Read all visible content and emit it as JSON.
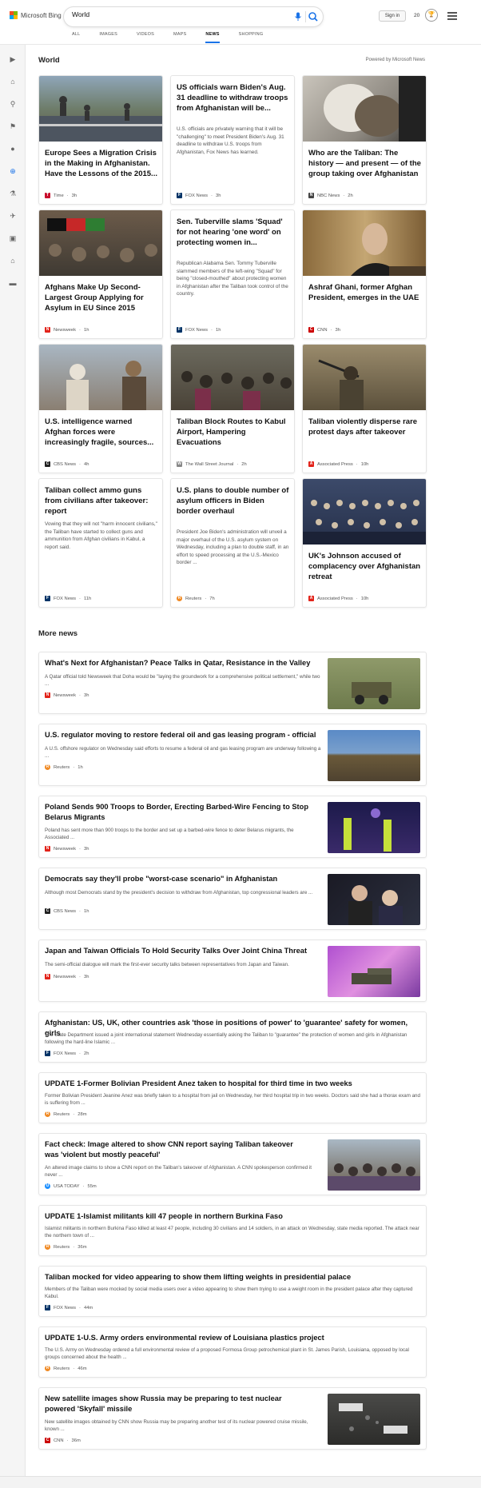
{
  "header": {
    "logo_text": "Microsoft Bing",
    "search_value": "World",
    "signin_label": "Sign in",
    "points": "20"
  },
  "tabs": [
    {
      "label": "ALL"
    },
    {
      "label": "IMAGES"
    },
    {
      "label": "VIDEOS"
    },
    {
      "label": "MAPS"
    },
    {
      "label": "NEWS",
      "active": true
    },
    {
      "label": "SHOPPING"
    }
  ],
  "rail_icons": [
    "chevron-right-icon",
    "home-icon",
    "sports-icon",
    "flag-icon",
    "location-icon",
    "globe-icon",
    "science-icon",
    "rocket-icon",
    "entertainment-icon",
    "politics-icon",
    "money-icon"
  ],
  "section": {
    "title": "World",
    "powered": "Powered by Microsoft News"
  },
  "cards": [
    {
      "title": "Europe Sees a Migration Crisis in the Making in Afghanistan. Have the Lessons of the 2015...",
      "snippet": "",
      "source": "Time",
      "time": "3h",
      "src_color": "#c8102e",
      "src_letter": "T",
      "img": true
    },
    {
      "title": "US officials warn Biden's Aug. 31 deadline to withdraw troops from Afghanistan will be...",
      "snippet": "U.S. officials are privately warning that it will be \"challenging\" to meet President Biden's Aug. 31 deadline to withdraw U.S. troops from Afghanistan, Fox News has learned.",
      "source": "FOX News",
      "time": "3h",
      "src_color": "#003366",
      "src_letter": "F",
      "img": false
    },
    {
      "title": "Who are the Taliban: The history — and present — of the group taking over Afghanistan",
      "snippet": "",
      "source": "NBC News",
      "time": "2h",
      "src_color": "#444",
      "src_letter": "N",
      "img": true
    },
    {
      "title": "Afghans Make Up Second-Largest Group Applying for Asylum in EU Since 2015",
      "snippet": "",
      "source": "Newsweek",
      "time": "1h",
      "src_color": "#e2231a",
      "src_letter": "N",
      "img": true
    },
    {
      "title": "Sen. Tuberville slams 'Squad' for not hearing 'one word' on protecting women in...",
      "snippet": "Republican Alabama Sen. Tommy Tuberville slammed members of the left-wing \"Squad\" for being \"closed-mouthed\" about protecting women in Afghanistan after the Taliban took control of the country.",
      "source": "FOX News",
      "time": "1h",
      "src_color": "#003366",
      "src_letter": "F",
      "img": false
    },
    {
      "title": "Ashraf Ghani, former Afghan President, emerges in the UAE",
      "snippet": "",
      "source": "CNN",
      "time": "3h",
      "src_color": "#cc0000",
      "src_letter": "C",
      "img": true
    },
    {
      "title": "U.S. intelligence warned Afghan forces were increasingly fragile, sources...",
      "snippet": "",
      "source": "CBS News",
      "time": "4h",
      "src_color": "#222",
      "src_letter": "C",
      "img": true
    },
    {
      "title": "Taliban Block Routes to Kabul Airport, Hampering Evacuations",
      "snippet": "",
      "source": "The Wall Street Journal",
      "time": "2h",
      "src_color": "#888",
      "src_letter": "W",
      "img": true
    },
    {
      "title": "Taliban violently disperse rare protest days after takeover",
      "snippet": "",
      "source": "Associated Press",
      "time": "10h",
      "src_color": "#e2231a",
      "src_letter": "A",
      "img": true
    },
    {
      "title": "Taliban collect ammo guns from civilians after takeover: report",
      "snippet": "Vowing that they will not \"harm innocent civilians,\" the Taliban have started to collect guns and ammunition from Afghan civilians in Kabul, a report said.",
      "source": "FOX News",
      "time": "11h",
      "src_color": "#003366",
      "src_letter": "F",
      "img": false
    },
    {
      "title": "U.S. plans to double number of asylum officers in Biden border overhaul",
      "snippet": "President Joe Biden's administration will unveil a major overhaul of the U.S. asylum system on Wednesday, including a plan to double staff, in an effort to speed processing at the U.S.-Mexico border ...",
      "source": "Reuters",
      "time": "7h",
      "src_color": "#f08a24",
      "src_letter": "R",
      "img": false
    },
    {
      "title": "UK's Johnson accused of complacency over Afghanistan retreat",
      "snippet": "",
      "source": "Associated Press",
      "time": "10h",
      "src_color": "#e2231a",
      "src_letter": "A",
      "img": true
    }
  ],
  "more": {
    "title": "More news"
  },
  "news": [
    {
      "title": "What's Next for Afghanistan? Peace Talks in Qatar, Resistance in the Valley",
      "snippet": "A Qatar official told Newsweek that Doha would be \"laying the groundwork for a comprehensive political settlement,\" while two ...",
      "source": "Newsweek",
      "time": "3h",
      "src_color": "#e2231a",
      "src_letter": "N",
      "img": true
    },
    {
      "title": "U.S. regulator moving to restore federal oil and gas leasing program - official",
      "snippet": "A U.S. offshore regulator on Wednesday said efforts to resume a federal oil and gas leasing program are underway following a ...",
      "source": "Reuters",
      "time": "1h",
      "src_color": "#f08a24",
      "src_letter": "R",
      "img": true
    },
    {
      "title": "Poland Sends 900 Troops to Border, Erecting Barbed-Wire Fencing to Stop Belarus Migrants",
      "snippet": "Poland has sent more than 900 troops to the border and set up a barbed-wire fence to deter Belarus migrants, the Associated ...",
      "source": "Newsweek",
      "time": "3h",
      "src_color": "#e2231a",
      "src_letter": "N",
      "img": true
    },
    {
      "title": "Democrats say they'll probe \"worst-case scenario\" in Afghanistan",
      "snippet": "Although most Democrats stand by the president's decision to withdraw from Afghanistan, top congressional leaders are ...",
      "source": "CBS News",
      "time": "1h",
      "src_color": "#222",
      "src_letter": "C",
      "img": true
    },
    {
      "title": "Japan and Taiwan Officials To Hold Security Talks Over Joint China Threat",
      "snippet": "The semi-official dialogue will mark the first-ever security talks between representatives from Japan and Taiwan.",
      "source": "Newsweek",
      "time": "3h",
      "src_color": "#e2231a",
      "src_letter": "N",
      "img": true
    },
    {
      "title": "Afghanistan: US, UK, other countries ask 'those in positions of power' to 'guarantee' safety for women, girls",
      "snippet": "The State Department issued a joint international statement Wednesday essentially asking the Taliban to \"guarantee\" the protection of women and girls in Afghanistan following the hard-line Islamic ...",
      "source": "FOX News",
      "time": "2h",
      "src_color": "#003366",
      "src_letter": "F",
      "img": false
    },
    {
      "title": "UPDATE 1-Former Bolivian President Anez taken to hospital for third time in two weeks",
      "snippet": "Former Bolivian President Jeanine Anez was briefly taken to a hospital from jail on Wednesday, her third hospital trip in two weeks. Doctors said she had a thorax exam and is suffering from ...",
      "source": "Reuters",
      "time": "28m",
      "src_color": "#f08a24",
      "src_letter": "R",
      "img": false
    },
    {
      "title": "Fact check: Image altered to show CNN report saying Taliban takeover was 'violent but mostly peaceful'",
      "snippet": "An altered image claims to show a CNN report on the Taliban's takeover of Afghanistan. A CNN spokesperson confirmed it never ...",
      "source": "USA TODAY",
      "time": "55m",
      "src_color": "#1e90ff",
      "src_letter": "U",
      "img": true
    },
    {
      "title": "UPDATE 1-Islamist militants kill 47 people in northern Burkina Faso",
      "snippet": "Islamist militants in northern Burkina Faso killed at least 47 people, including 30 civilians and 14 soldiers, in an attack on Wednesday, state media reported. The attack near the northern town of ...",
      "source": "Reuters",
      "time": "36m",
      "src_color": "#f08a24",
      "src_letter": "R",
      "img": false
    },
    {
      "title": "Taliban mocked for video appearing to show them lifting weights in presidential palace",
      "snippet": "Members of the Taliban were mocked by social media users over a video appearing to show them trying to use a weight room in the president palace after they captured Kabul.",
      "source": "FOX News",
      "time": "44m",
      "src_color": "#003366",
      "src_letter": "F",
      "img": false
    },
    {
      "title": "UPDATE 1-U.S. Army orders environmental review of Louisiana plastics project",
      "snippet": "The U.S. Army on Wednesday ordered a full environmental review of a proposed Formosa Group petrochemical plant in St. James Parish, Louisiana, opposed by local groups concerned about the health ...",
      "source": "Reuters",
      "time": "46m",
      "src_color": "#f08a24",
      "src_letter": "R",
      "img": false
    },
    {
      "title": "New satellite images show Russia may be preparing to test nuclear powered 'Skyfall' missile",
      "snippet": "New satellite images obtained by CNN show Russia may be preparing another test of its nuclear powered cruise missile, known ...",
      "source": "CNN",
      "time": "36m",
      "src_color": "#cc0000",
      "src_letter": "C",
      "img": true
    }
  ]
}
